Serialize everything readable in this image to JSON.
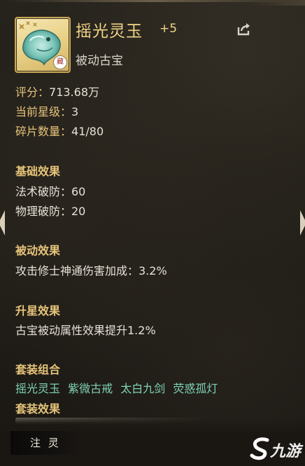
{
  "item": {
    "name": "摇光灵玉",
    "level": "+5",
    "type": "被动古宝",
    "icon": "jade-creature-icon",
    "badge": "藏"
  },
  "stats": {
    "score_label": "评分：",
    "score_value": "713.68万",
    "star_label": "当前星级：",
    "star_value": "3",
    "fragment_label": "碎片数量：",
    "fragment_value": "41/80"
  },
  "basic": {
    "title": "基础效果",
    "lines": [
      "法术破防：60",
      "物理破防：20"
    ]
  },
  "passive": {
    "title": "被动效果",
    "text": "攻击修士神通伤害加成：3.2%"
  },
  "star_up": {
    "title": "升星效果",
    "text": "古宝被动属性效果提升1.2%"
  },
  "set": {
    "title": "套装组合",
    "items": [
      "摇光灵玉",
      "紫微古戒",
      "太白九剑",
      "荧惑孤灯"
    ],
    "effect_title": "套装效果"
  },
  "actions": {
    "zhuling": "注 灵"
  },
  "watermark": {
    "text": "九游"
  },
  "colors": {
    "gold": "#f1d486",
    "section": "#e6c47a",
    "set_item": "#7fd3b6",
    "background": "#1f1c17"
  }
}
